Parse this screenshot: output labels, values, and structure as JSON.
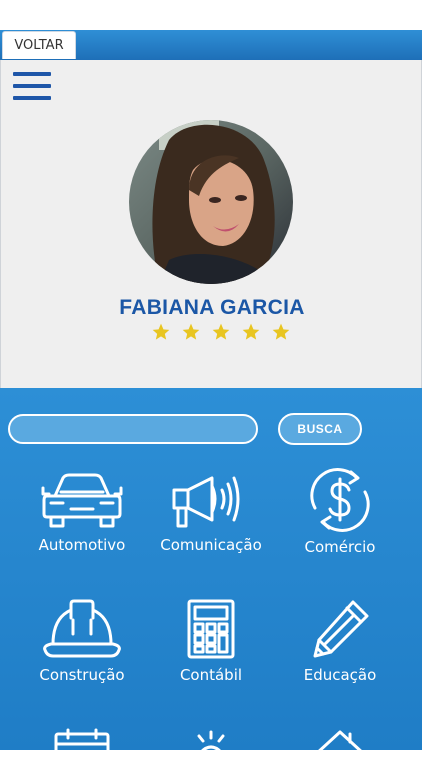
{
  "header": {
    "back_label": "VOLTAR"
  },
  "profile": {
    "name": "FABIANA GARCIA",
    "rating": 5,
    "rating_max": 5
  },
  "search": {
    "value": "",
    "placeholder": "",
    "button_label": "BUSCA"
  },
  "categories": [
    {
      "label": "Automotivo",
      "icon": "car-icon"
    },
    {
      "label": "Comunicação",
      "icon": "megaphone-icon"
    },
    {
      "label": "Comércio",
      "icon": "dollar-cycle-icon"
    },
    {
      "label": "Construção",
      "icon": "hard-hat-icon"
    },
    {
      "label": "Contábil",
      "icon": "calculator-icon"
    },
    {
      "label": "Educação",
      "icon": "pencil-icon"
    }
  ],
  "colors": {
    "header_blue": "#1e6fb8",
    "main_blue": "#2d8fd6",
    "name_blue": "#1b57a6",
    "star_yellow": "#e8c520"
  }
}
